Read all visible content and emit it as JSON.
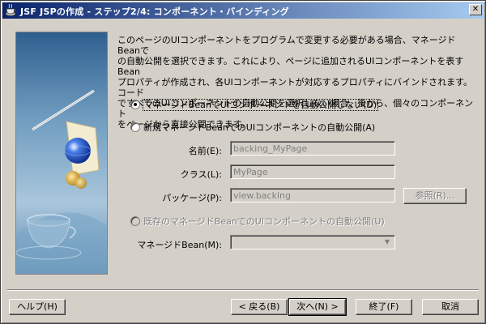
{
  "window": {
    "title": "JSF JSPの作成 - ステップ2/4: コンポーネント・バインディング",
    "close_glyph": "✕"
  },
  "intro": {
    "text": "このページのUIコンポーネントをプログラムで変更する必要がある場合、マネージドBeanで\nの自動公開を選択できます。これにより、ページに追加されるUIコンポーネントを表すBean\nプロパティが作成され、各UIコンポーネントが対応するプロパティにバインドされます。コード\nですべてのUIコンポーネントの自動公開を選択しない場合、後から、個々のコンポーネント\nをページから直接公開できます。"
  },
  "options": {
    "no_expose": {
      "label": "マネージドBeanでUIコンポーネントを自動公開しない(D)",
      "checked": true
    },
    "new_bean": {
      "label": "新規マネージドBeanでのUIコンポーネントの自動公開(A)",
      "checked": false
    },
    "existing_bean": {
      "label": "既存のマネージドBeanでのUIコンポーネントの自動公開(U)",
      "enabled": false
    }
  },
  "form": {
    "name_label": "名前(E):",
    "name_value": "backing_MyPage",
    "class_label": "クラス(L):",
    "class_value": "MyPage",
    "package_label": "パッケージ(P):",
    "package_value": "view.backing",
    "browse_label": "参照(R)...",
    "managed_bean_label": "マネージドBean(M):",
    "managed_bean_value": ""
  },
  "buttons": {
    "help": "ヘルプ(H)",
    "back": "< 戻る(B)",
    "next": "次へ(N) >",
    "finish": "終了(F)",
    "cancel": "取消"
  },
  "colors": {
    "title_start": "#0a246a",
    "title_end": "#a6caf0",
    "dialog_bg": "#d4d0c8",
    "panel_bg": "#6f9cbf"
  }
}
